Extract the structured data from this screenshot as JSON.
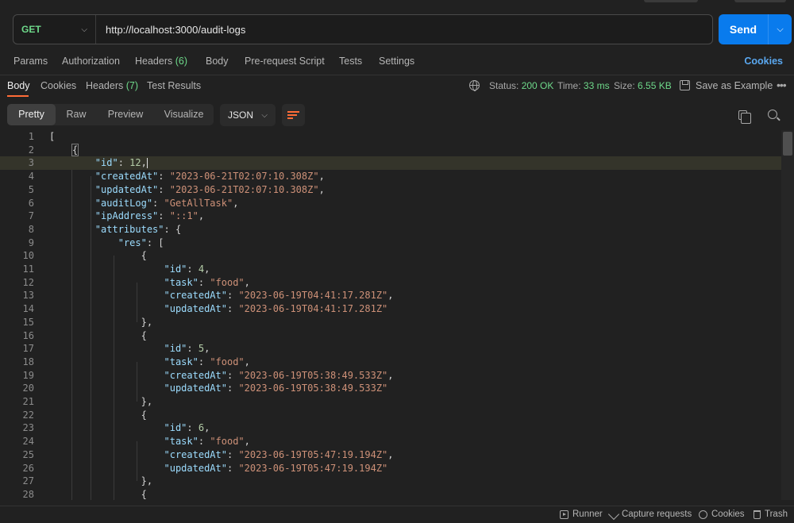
{
  "request": {
    "method": "GET",
    "url": "http://localhost:3000/audit-logs",
    "send_label": "Send"
  },
  "request_tabs": [
    {
      "label": "Params"
    },
    {
      "label": "Authorization"
    },
    {
      "label": "Headers",
      "count": "(6)"
    },
    {
      "label": "Body"
    },
    {
      "label": "Pre-request Script"
    },
    {
      "label": "Tests"
    },
    {
      "label": "Settings"
    }
  ],
  "cookies_link": "Cookies",
  "response_tabs": [
    {
      "label": "Body"
    },
    {
      "label": "Cookies"
    },
    {
      "label": "Headers",
      "count": "(7)"
    },
    {
      "label": "Test Results"
    }
  ],
  "response_meta": {
    "status_label": "Status:",
    "status_value": "200 OK",
    "time_label": "Time:",
    "time_value": "33 ms",
    "size_label": "Size:",
    "size_value": "6.55 KB",
    "save_label": "Save as Example",
    "more_label": "•••"
  },
  "view_modes": [
    "Pretty",
    "Raw",
    "Preview",
    "Visualize"
  ],
  "format": "JSON",
  "code_lines": [
    "[",
    "    {",
    "        \"id\": 12,",
    "        \"createdAt\": \"2023-06-21T02:07:10.308Z\",",
    "        \"updatedAt\": \"2023-06-21T02:07:10.308Z\",",
    "        \"auditLog\": \"GetAllTask\",",
    "        \"ipAddress\": \"::1\",",
    "        \"attributes\": {",
    "            \"res\": [",
    "                {",
    "                    \"id\": 4,",
    "                    \"task\": \"food\",",
    "                    \"createdAt\": \"2023-06-19T04:41:17.281Z\",",
    "                    \"updatedAt\": \"2023-06-19T04:41:17.281Z\"",
    "                },",
    "                {",
    "                    \"id\": 5,",
    "                    \"task\": \"food\",",
    "                    \"createdAt\": \"2023-06-19T05:38:49.533Z\",",
    "                    \"updatedAt\": \"2023-06-19T05:38:49.533Z\"",
    "                },",
    "                {",
    "                    \"id\": 6,",
    "                    \"task\": \"food\",",
    "                    \"createdAt\": \"2023-06-19T05:47:19.194Z\",",
    "                    \"updatedAt\": \"2023-06-19T05:47:19.194Z\"",
    "                },",
    "                {"
  ],
  "highlighted_line": 3,
  "status_bar": {
    "runner": "Runner",
    "capture": "Capture requests",
    "cookies": "Cookies",
    "trash": "Trash"
  },
  "colors": {
    "accent": "#ff6c37",
    "send": "#097bed",
    "success": "#6ed98a",
    "link": "#5aa8f0"
  }
}
